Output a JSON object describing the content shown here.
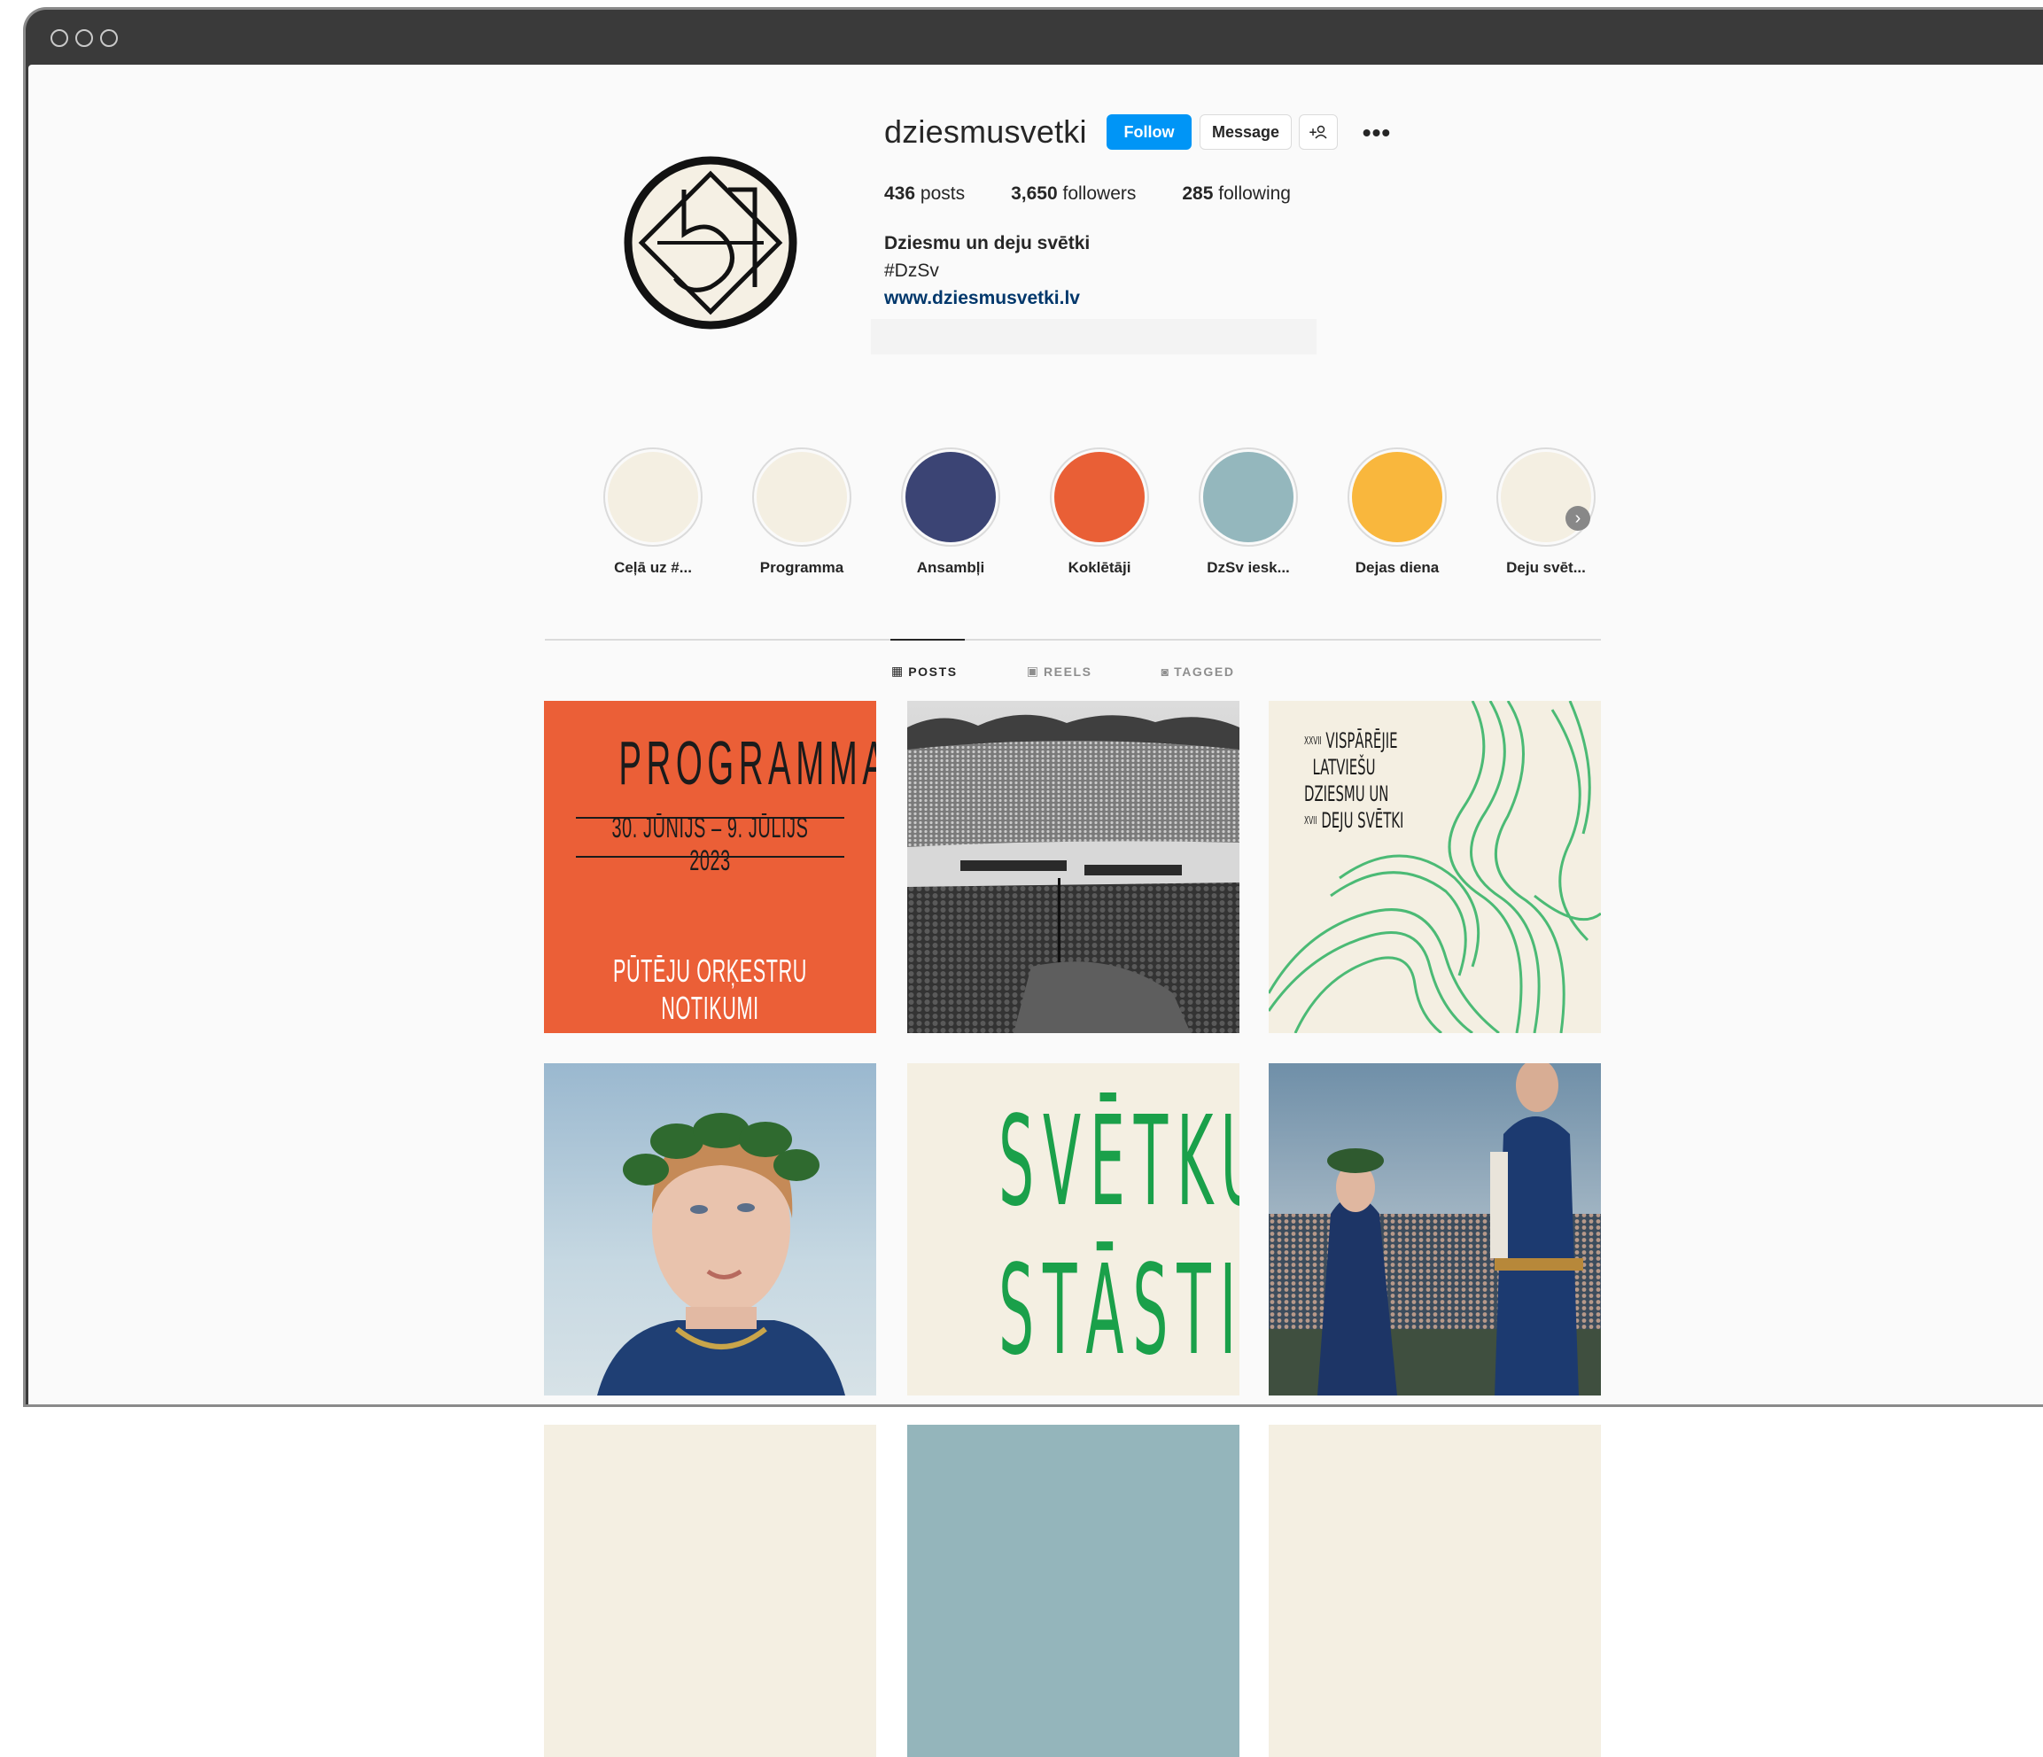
{
  "browser": {
    "buttons": [
      "close",
      "minimize",
      "zoom"
    ]
  },
  "profile": {
    "username": "dziesmusvetki",
    "follow_label": "Follow",
    "message_label": "Message",
    "suggest_icon": "+",
    "more_icon": "•••",
    "stats": {
      "posts_count": "436",
      "posts_label": "posts",
      "followers_count": "3,650",
      "followers_label": "followers",
      "following_count": "285",
      "following_label": "following"
    },
    "bio": {
      "name": "Dziesmu un deju svētki",
      "hashtag": "#DzSv",
      "link": "www.dziesmusvetki.lv"
    }
  },
  "highlights": [
    {
      "label": "Ceļā uz #...",
      "color": "#f4efe2"
    },
    {
      "label": "Programma",
      "color": "#f4efe2"
    },
    {
      "label": "Ansambļi",
      "color": "#3b4474"
    },
    {
      "label": "Koklētāji",
      "color": "#e95f36"
    },
    {
      "label": "DzSv iesk...",
      "color": "#94b7bd"
    },
    {
      "label": "Dejas diena",
      "color": "#f9b73d"
    },
    {
      "label": "Deju svēt...",
      "color": "#f4efe2"
    }
  ],
  "tabs": [
    {
      "label": "POSTS",
      "icon": "grid-icon",
      "active": true
    },
    {
      "label": "REELS",
      "icon": "reels-icon",
      "active": false
    },
    {
      "label": "TAGGED",
      "icon": "tagged-icon",
      "active": false
    }
  ],
  "posts": {
    "programma": {
      "title": "PROGRAMMA",
      "dates": "30. JŪNIJS – 9. JŪLIJS 2023",
      "subtitle": "PŪTĒJU ORĶESTRU NOTIKUMI"
    },
    "vispareji": {
      "line1_num": "XXVII",
      "line1": "VISPĀRĒJIE",
      "line2": "LATVIEŠU",
      "line3": "DZIESMU UN",
      "line4_num": "XVII",
      "line4": "DEJU SVĒTKI"
    },
    "stasti": {
      "word1": "SVĒTKU",
      "word2": "STĀSTI"
    }
  }
}
